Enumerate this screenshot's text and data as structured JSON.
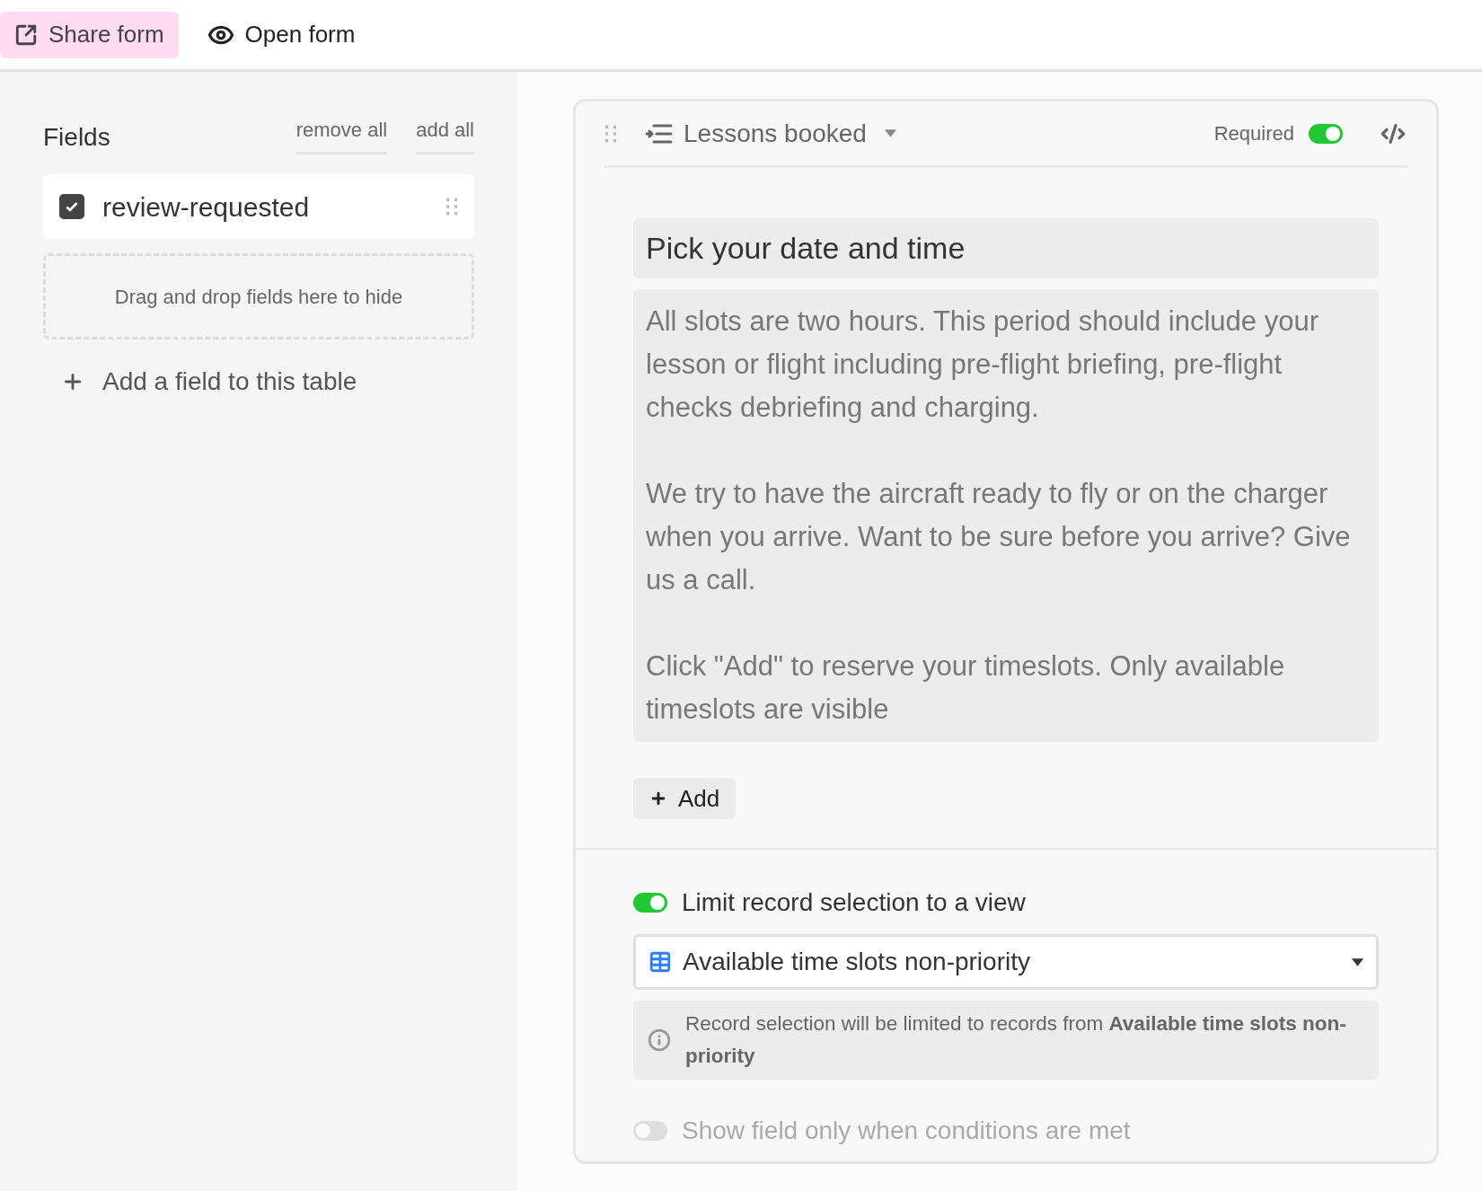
{
  "toolbar": {
    "buttons": [
      {
        "kind": "share",
        "label": "Share form",
        "selected": true
      },
      {
        "kind": "open",
        "label": "Open form",
        "selected": false
      }
    ]
  },
  "fields_panel": {
    "title": "Fields",
    "actions": [
      "remove all",
      "add all"
    ],
    "fields": [
      {
        "label": "review-requested",
        "checked": true
      }
    ],
    "drop_zone": "Drag and drop fields here to hide",
    "add_field": "Add a field to this table"
  },
  "field_card": {
    "field_name": "Lessons booked",
    "required_label": "Required",
    "required": true,
    "title": "Pick your date and time",
    "description": [
      "All slots are two hours. This period should include your lesson or flight including pre-flight briefing, pre-flight checks debriefing and charging.",
      "We try to have the aircraft ready to fly or on the charger when you arrive. Want to be sure before you arrive? Give us a call.",
      "Click \"Add\" to reserve your timeslots. Only available timeslots are visible"
    ],
    "add_button": "Add",
    "options": [
      {
        "kind": "limit_view",
        "label": "Limit record selection to a view",
        "on": true
      },
      {
        "kind": "conditions",
        "label": "Show field only when conditions are met",
        "on": false
      }
    ],
    "view_select": {
      "value": "Available time slots non-priority"
    },
    "info": "Record selection will be limited to records from **Available time slots non-priority**"
  }
}
